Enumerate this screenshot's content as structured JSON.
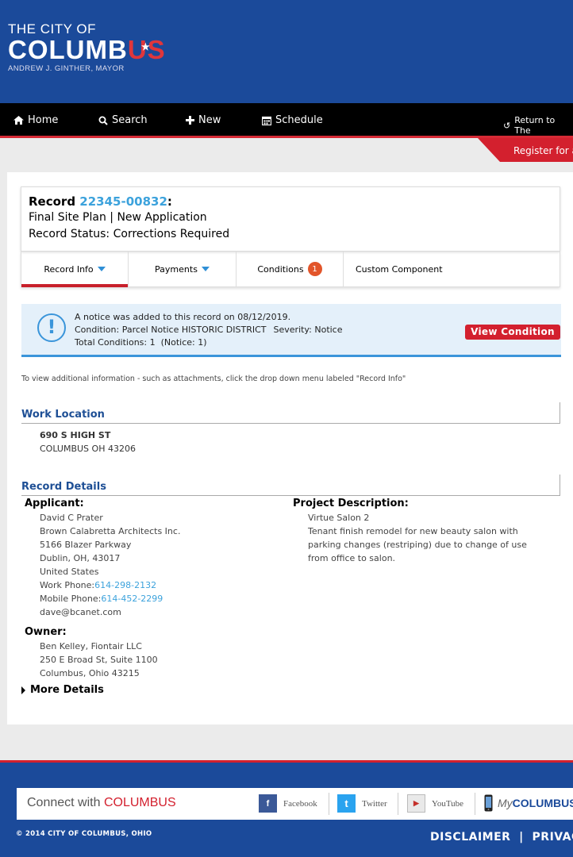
{
  "header": {
    "logo_line1": "THE CITY OF",
    "logo_line2_main": "COLUMB",
    "logo_line2_accent": "US",
    "logo_line3": "ANDREW J. GINTHER, MAYOR"
  },
  "nav": {
    "home": "Home",
    "search": "Search",
    "new": "New",
    "schedule": "Schedule",
    "return": "Return to The"
  },
  "register": "Register for a",
  "record": {
    "label": "Record ",
    "number": "22345-00832",
    "colon": ":",
    "type": "Final Site Plan | New Application",
    "status": "Record Status: Corrections Required"
  },
  "tabs": {
    "record_info": "Record Info",
    "payments": "Payments",
    "conditions": "Conditions",
    "conditions_count": "1",
    "custom": "Custom Component"
  },
  "notice": {
    "line1": "A notice was added to this record on 08/12/2019.",
    "condition_label": "Condition:",
    "condition_value": "Parcel Notice HISTORIC DISTRICT",
    "severity_label": "Severity:",
    "severity_value": "Notice",
    "total": "Total Conditions: 1  (Notice: 1)",
    "button": "View Condition"
  },
  "info_line": "To view additional information - such as attachments, click the drop down menu labeled \"Record Info\"",
  "work_location": {
    "title": "Work Location",
    "line1": "690 S HIGH ST",
    "line2": "COLUMBUS OH 43206"
  },
  "record_details": {
    "title": "Record Details",
    "applicant_label": "Applicant:",
    "applicant": {
      "name": "David C Prater",
      "company": "Brown Calabretta Architects Inc.",
      "street": "5166 Blazer Parkway",
      "city": "Dublin, OH, 43017",
      "country": "United States",
      "work_label": "Work Phone:",
      "work_phone": "614-298-2132",
      "mobile_label": "Mobile Phone:",
      "mobile_phone": "614-452-2299",
      "email": "dave@bcanet.com"
    },
    "owner_label": "Owner:",
    "owner": {
      "name": "Ben Kelley, Fiontair LLC",
      "street": "250 E Broad St, Suite 1100",
      "city": "Columbus, Ohio 43215"
    },
    "project_label": "Project Description:",
    "project": {
      "name": "Virtue Salon 2",
      "description": "Tenant finish remodel for new beauty salon with parking changes (restriping) due to change of use from office to salon."
    },
    "more": "More Details"
  },
  "footer": {
    "connect_prefix": "Connect with ",
    "connect_brand": "COLUMBUS",
    "facebook": "Facebook",
    "twitter": "Twitter",
    "youtube": "YouTube",
    "my_prefix": "My",
    "my_brand": "COLUMBUS",
    "copyright": "© 2014 CITY OF COLUMBUS, OHIO",
    "disclaimer": "DISCLAIMER  |  PRIVACY"
  },
  "colors": {
    "brand_blue": "#1b4a9a",
    "accent_red": "#d3202e",
    "link_blue": "#3ca2dc"
  }
}
